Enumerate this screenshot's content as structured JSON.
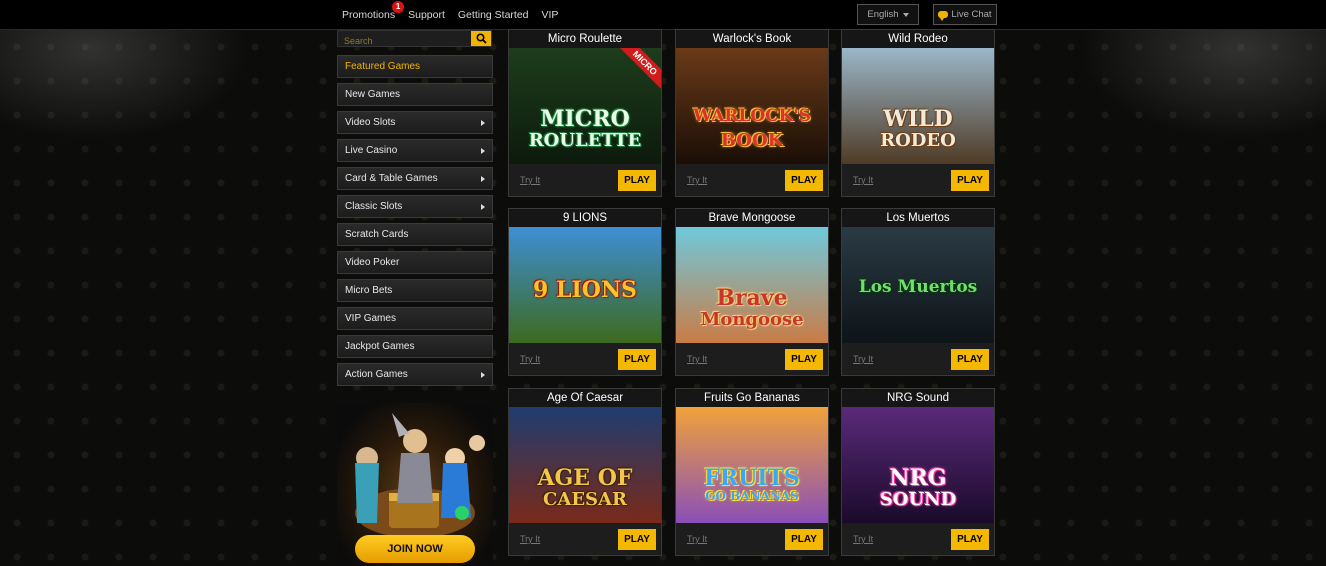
{
  "nav": {
    "items": [
      "Promotions",
      "Support",
      "Getting Started",
      "VIP"
    ],
    "promotions_badge": "1",
    "language": "English",
    "live_chat": "Live Chat"
  },
  "search": {
    "placeholder": "Search"
  },
  "menu": [
    {
      "label": "Featured Games",
      "active": true,
      "arrow": false
    },
    {
      "label": "New Games",
      "active": false,
      "arrow": false
    },
    {
      "label": "Video Slots",
      "active": false,
      "arrow": true
    },
    {
      "label": "Live Casino",
      "active": false,
      "arrow": true
    },
    {
      "label": "Card & Table Games",
      "active": false,
      "arrow": true
    },
    {
      "label": "Classic Slots",
      "active": false,
      "arrow": true
    },
    {
      "label": "Scratch Cards",
      "active": false,
      "arrow": false
    },
    {
      "label": "Video Poker",
      "active": false,
      "arrow": false
    },
    {
      "label": "Micro Bets",
      "active": false,
      "arrow": false
    },
    {
      "label": "VIP Games",
      "active": false,
      "arrow": false
    },
    {
      "label": "Jackpot Games",
      "active": false,
      "arrow": false
    },
    {
      "label": "Action Games",
      "active": false,
      "arrow": true
    }
  ],
  "promo": {
    "join_label": "JOIN NOW"
  },
  "games": [
    {
      "title": "Micro Roulette",
      "logo": "MICRO",
      "sublogo": "ROULETTE",
      "corner": "MICRO",
      "bg1": "#1d3d1c",
      "bg2": "#0d1a0c",
      "logo_color": "#e8ffe8",
      "logo_stroke": "#1a7a3a",
      "try": "Try It",
      "play": "PLAY"
    },
    {
      "title": "Warlock's Book",
      "logo": "WARLOCK'S",
      "sublogo": "BOOK",
      "corner": "",
      "bg1": "#6a3a18",
      "bg2": "#1a0e06",
      "logo_color": "#e0302a",
      "logo_stroke": "#f4c040",
      "try": "Try It",
      "play": "PLAY"
    },
    {
      "title": "Wild Rodeo",
      "logo": "WILD",
      "sublogo": "RODEO",
      "corner": "",
      "bg1": "#9bb7c9",
      "bg2": "#4f3b26",
      "logo_color": "#f2ead8",
      "logo_stroke": "#6b3e18",
      "try": "Try It",
      "play": "PLAY"
    },
    {
      "title": "9 LIONS",
      "logo": "9 LIONS",
      "sublogo": "",
      "corner": "",
      "bg1": "#3e8fd6",
      "bg2": "#3d6a1e",
      "logo_color": "#f7c62a",
      "logo_stroke": "#a0160f",
      "try": "Try It",
      "play": "PLAY"
    },
    {
      "title": "Brave Mongoose",
      "logo": "Brave",
      "sublogo": "Mongoose",
      "corner": "",
      "bg1": "#6fc9dd",
      "bg2": "#c97b45",
      "logo_color": "#c8352a",
      "logo_stroke": "#f5d27a",
      "try": "Try It",
      "play": "PLAY"
    },
    {
      "title": "Los Muertos",
      "logo": "Los Muertos",
      "sublogo": "",
      "corner": "",
      "bg1": "#2a3a44",
      "bg2": "#0e1418",
      "logo_color": "#6fe06a",
      "logo_stroke": "#0b3a12",
      "try": "Try It",
      "play": "PLAY"
    },
    {
      "title": "Age Of Caesar",
      "logo": "AGE OF",
      "sublogo": "CAESAR",
      "corner": "",
      "bg1": "#1f3c70",
      "bg2": "#7a2a1a",
      "logo_color": "#f2c64a",
      "logo_stroke": "#3a220a",
      "try": "Try It",
      "play": "PLAY"
    },
    {
      "title": "Fruits Go Bananas",
      "logo": "FRUITS",
      "sublogo": "GO BANANAS",
      "corner": "",
      "bg1": "#f0a23a",
      "bg2": "#8a4fb8",
      "logo_color": "#3aa7ff",
      "logo_stroke": "#ffe23a",
      "try": "Try It",
      "play": "PLAY"
    },
    {
      "title": "NRG Sound",
      "logo": "NRG",
      "sublogo": "SOUND",
      "corner": "",
      "bg1": "#5a2a7a",
      "bg2": "#1a0a2a",
      "logo_color": "#ffffff",
      "logo_stroke": "#ff3aa8",
      "try": "Try It",
      "play": "PLAY"
    }
  ]
}
